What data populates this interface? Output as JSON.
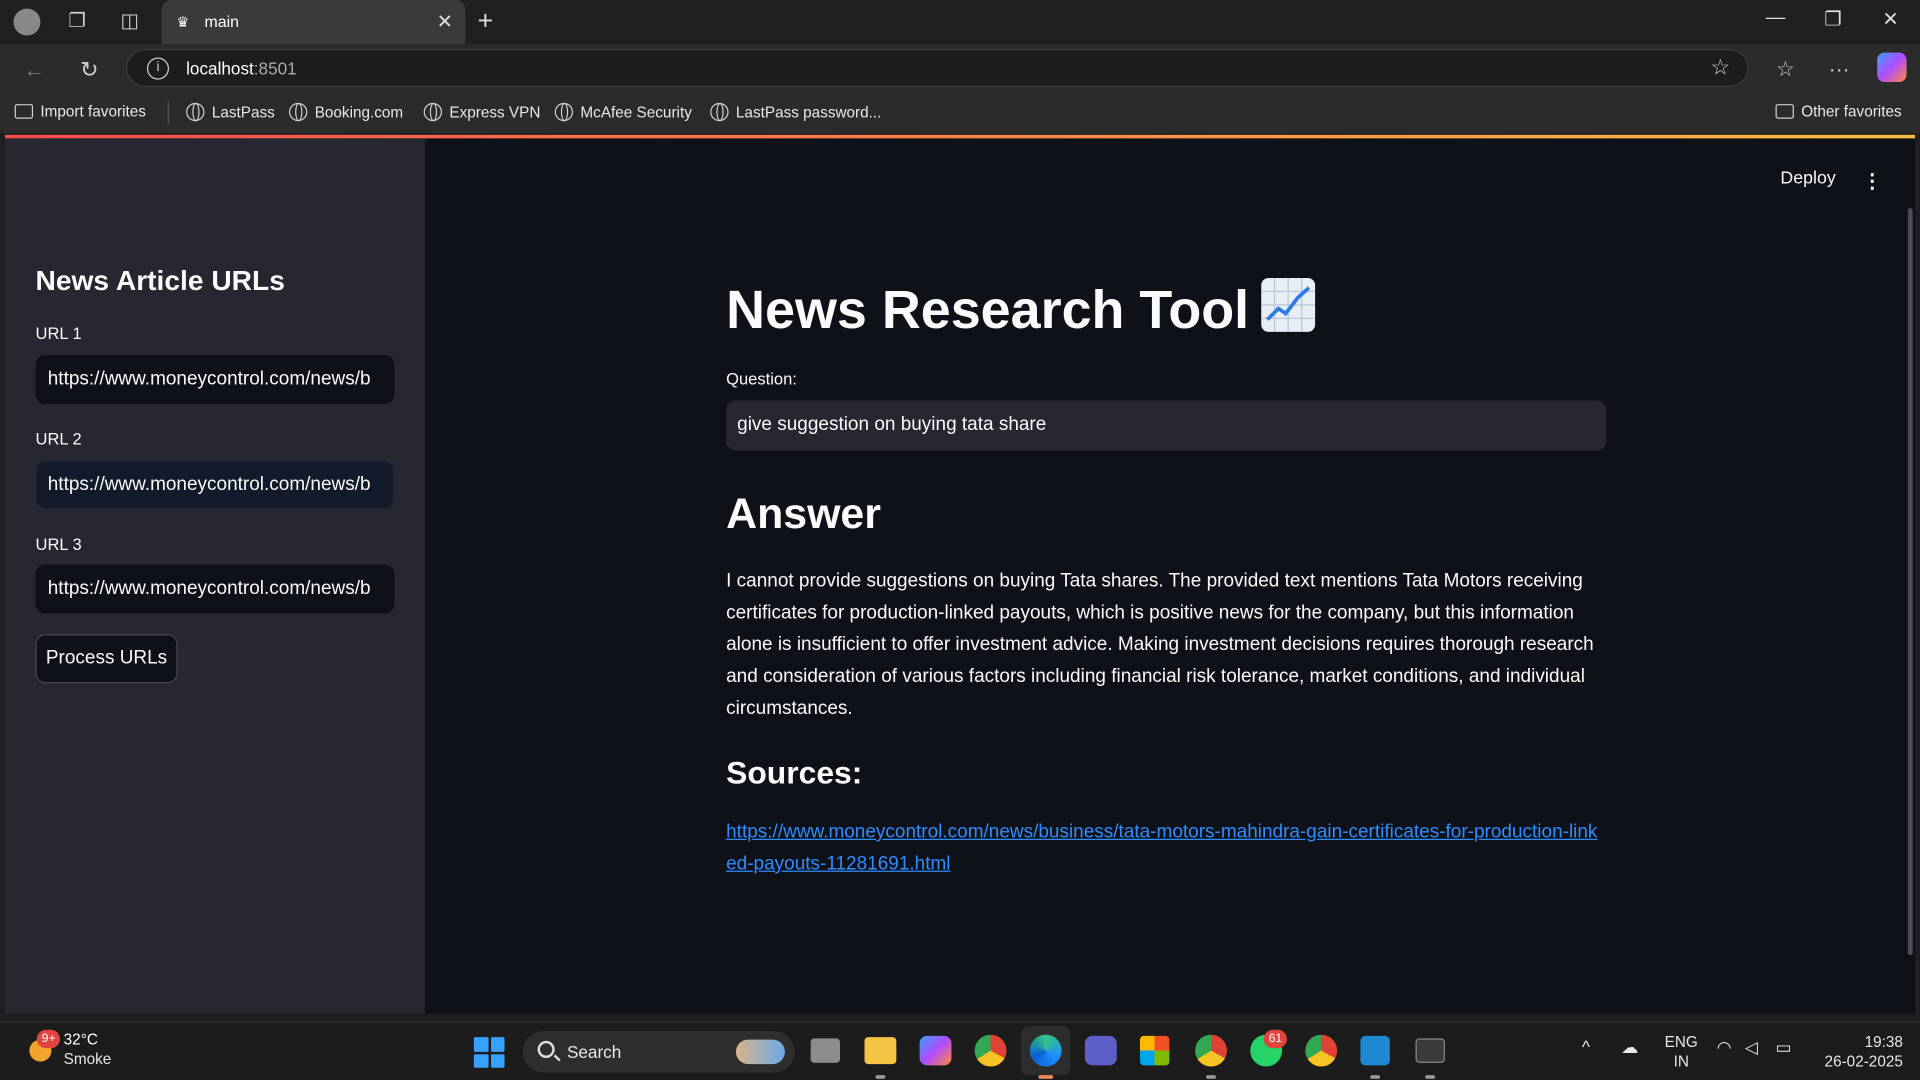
{
  "browser": {
    "tab_title": "main",
    "url_host": "localhost",
    "url_port": ":8501",
    "favorites": [
      "Import favorites",
      "LastPass",
      "Booking.com",
      "Express VPN",
      "McAfee Security",
      "LastPass password..."
    ],
    "other_favorites": "Other favorites"
  },
  "app": {
    "deploy_label": "Deploy",
    "sidebar": {
      "title": "News Article URLs",
      "url1_label": "URL 1",
      "url1_value": "https://www.moneycontrol.com/news/b",
      "url2_label": "URL 2",
      "url2_value": "https://www.moneycontrol.com/news/b",
      "url3_label": "URL 3",
      "url3_value": "https://www.moneycontrol.com/news/b",
      "process_button": "Process URLs"
    },
    "main": {
      "title": "News Research Tool",
      "question_label": "Question:",
      "question_value": "give suggestion on buying tata share",
      "answer_heading": "Answer",
      "answer_text": "I cannot provide suggestions on buying Tata shares. The provided text mentions Tata Motors receiving certificates for production-linked payouts, which is positive news for the company, but this information alone is insufficient to offer investment advice. Making investment decisions requires thorough research and consideration of various factors including financial risk tolerance, market conditions, and individual circumstances.",
      "sources_heading": "Sources:",
      "source_link": "https://www.moneycontrol.com/news/business/tata-motors-mahindra-gain-certificates-for-production-linked-payouts-11281691.html"
    }
  },
  "taskbar": {
    "weather_badge": "9+",
    "temperature": "32°C",
    "condition": "Smoke",
    "search_label": "Search",
    "whatsapp_badge": "61",
    "language_top": "ENG",
    "language_bottom": "IN",
    "time": "19:38",
    "date": "26-02-2025"
  },
  "colors": {
    "page_bg": "#0e1117",
    "sidebar_bg": "#262730",
    "link": "#2f8cff",
    "accent_gradient_start": "#ff4b4b",
    "accent_gradient_end": "#ffbd45"
  }
}
